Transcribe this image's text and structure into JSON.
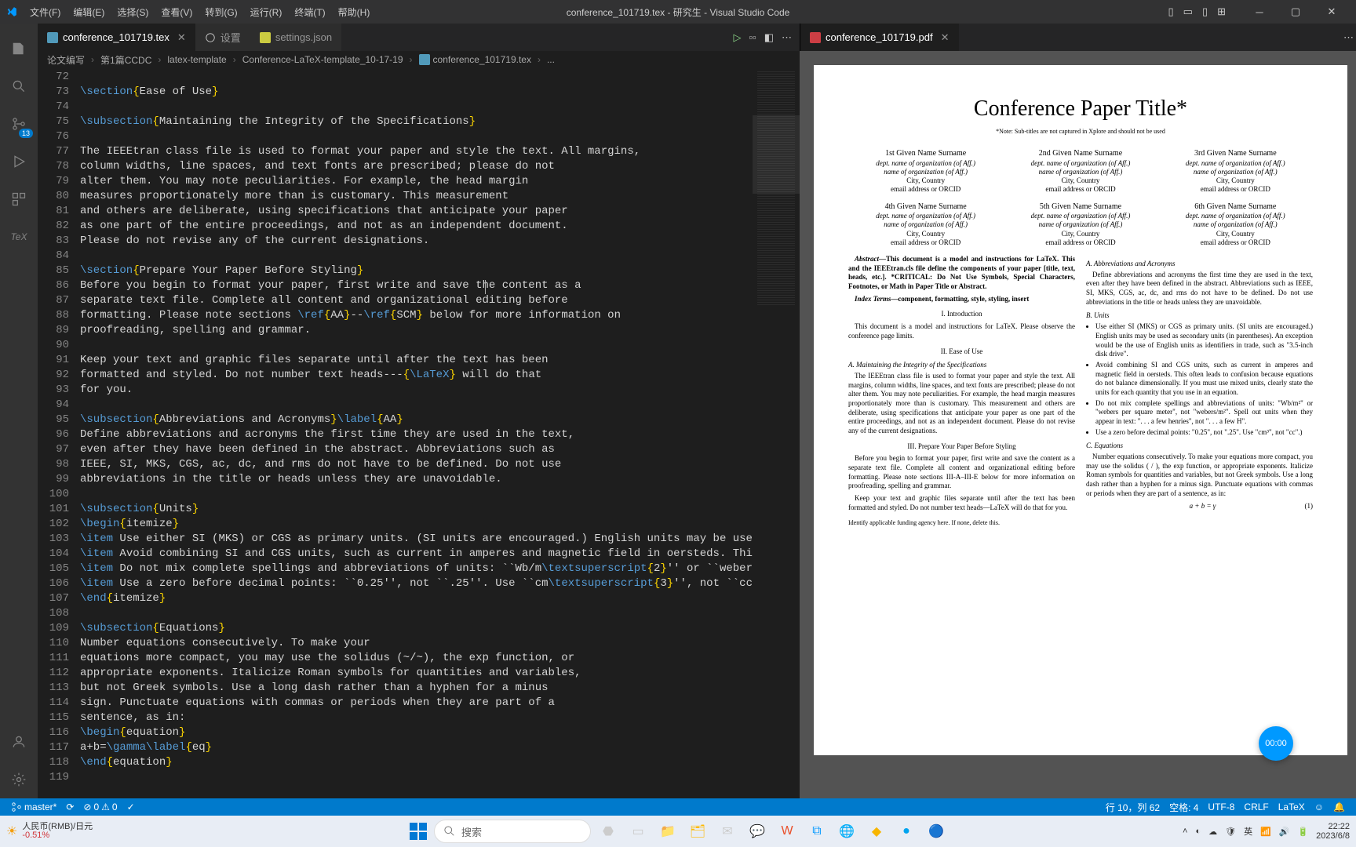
{
  "menubar": [
    "文件(F)",
    "编辑(E)",
    "选择(S)",
    "查看(V)",
    "转到(G)",
    "运行(R)",
    "终端(T)",
    "帮助(H)"
  ],
  "window_title": "conference_101719.tex - 研究生 - Visual Studio Code",
  "tabs_left": [
    {
      "label": "conference_101719.tex",
      "active": true
    },
    {
      "label": "设置",
      "active": false
    },
    {
      "label": "settings.json",
      "active": false
    }
  ],
  "tabs_right": [
    {
      "label": "conference_101719.pdf",
      "active": true
    }
  ],
  "breadcrumb": [
    "论文编写",
    "第1篇CCDC",
    "latex-template",
    "Conference-LaTeX-template_10-17-19",
    "conference_101719.tex",
    "..."
  ],
  "activity_badge": "13",
  "line_start": 72,
  "code_lines": [
    "",
    "\\section{Ease of Use}",
    "",
    "\\subsection{Maintaining the Integrity of the Specifications}",
    "",
    "The IEEEtran class file is used to format your paper and style the text. All margins, ",
    "column widths, line spaces, and text fonts are prescribed; please do not ",
    "alter them. You may note peculiarities. For example, the head margin",
    "measures proportionately more than is customary. This measurement ",
    "and others are deliberate, using specifications that anticipate your paper ",
    "as one part of the entire proceedings, and not as an independent document. ",
    "Please do not revise any of the current designations.",
    "",
    "\\section{Prepare Your Paper Before Styling}",
    "Before you begin to format your paper, first write and save the content as a ",
    "separate text file. Complete all content and organizational editing before ",
    "formatting. Please note sections \\ref{AA}--\\ref{SCM} below for more information on ",
    "proofreading, spelling and grammar.",
    "",
    "Keep your text and graphic files separate until after the text has been ",
    "formatted and styled. Do not number text heads---{\\LaTeX} will do that ",
    "for you.",
    "",
    "\\subsection{Abbreviations and Acronyms}\\label{AA}",
    "Define abbreviations and acronyms the first time they are used in the text, ",
    "even after they have been defined in the abstract. Abbreviations such as ",
    "IEEE, SI, MKS, CGS, ac, dc, and rms do not have to be defined. Do not use ",
    "abbreviations in the title or heads unless they are unavoidable.",
    "",
    "\\subsection{Units}",
    "\\begin{itemize}",
    "\\item Use either SI (MKS) or CGS as primary units. (SI units are encouraged.) English units may be use",
    "\\item Avoid combining SI and CGS units, such as current in amperes and magnetic field in oersteds. Thi",
    "\\item Do not mix complete spellings and abbreviations of units: ``Wb/m\\textsuperscript{2}'' or ``weber",
    "\\item Use a zero before decimal points: ``0.25'', not ``.25''. Use ``cm\\textsuperscript{3}'', not ``cc",
    "\\end{itemize}",
    "",
    "\\subsection{Equations}",
    "Number equations consecutively. To make your ",
    "equations more compact, you may use the solidus (~/~), the exp function, or ",
    "appropriate exponents. Italicize Roman symbols for quantities and variables, ",
    "but not Greek symbols. Use a long dash rather than a hyphen for a minus ",
    "sign. Punctuate equations with commas or periods when they are part of a ",
    "sentence, as in:",
    "\\begin{equation}",
    "a+b=\\gamma\\label{eq}",
    "\\end{equation}",
    ""
  ],
  "pdf": {
    "title": "Conference Paper Title*",
    "subtitle": "*Note: Sub-titles are not captured in Xplore and should not be used",
    "authors": [
      {
        "ord": "1st",
        "name": "Given Name Surname",
        "dept": "dept. name of organization (of Aff.)",
        "org": "name of organization (of Aff.)",
        "city": "City, Country",
        "email": "email address or ORCID"
      },
      {
        "ord": "2nd",
        "name": "Given Name Surname",
        "dept": "dept. name of organization (of Aff.)",
        "org": "name of organization (of Aff.)",
        "city": "City, Country",
        "email": "email address or ORCID"
      },
      {
        "ord": "3rd",
        "name": "Given Name Surname",
        "dept": "dept. name of organization (of Aff.)",
        "org": "name of organization (of Aff.)",
        "city": "City, Country",
        "email": "email address or ORCID"
      },
      {
        "ord": "4th",
        "name": "Given Name Surname",
        "dept": "dept. name of organization (of Aff.)",
        "org": "name of organization (of Aff.)",
        "city": "City, Country",
        "email": "email address or ORCID"
      },
      {
        "ord": "5th",
        "name": "Given Name Surname",
        "dept": "dept. name of organization (of Aff.)",
        "org": "name of organization (of Aff.)",
        "city": "City, Country",
        "email": "email address or ORCID"
      },
      {
        "ord": "6th",
        "name": "Given Name Surname",
        "dept": "dept. name of organization (of Aff.)",
        "org": "name of organization (of Aff.)",
        "city": "City, Country",
        "email": "email address or ORCID"
      }
    ],
    "abstract_label": "Abstract—",
    "abstract": "This document is a model and instructions for LaTeX. This and the IEEEtran.cls file define the components of your paper [title, text, heads, etc.]. *CRITICAL: Do Not Use Symbols, Special Characters, Footnotes, or Math in Paper Title or Abstract.",
    "index_label": "Index Terms—",
    "index": "component, formatting, style, styling, insert",
    "sec_intro": "I. Introduction",
    "intro_body": "This document is a model and instructions for LaTeX. Please observe the conference page limits.",
    "sec_ease": "II. Ease of Use",
    "sub_maint": "A. Maintaining the Integrity of the Specifications",
    "maint_body": "The IEEEtran class file is used to format your paper and style the text. All margins, column widths, line spaces, and text fonts are prescribed; please do not alter them. You may note peculiarities. For example, the head margin measures proportionately more than is customary. This measurement and others are deliberate, using specifications that anticipate your paper as one part of the entire proceedings, and not as an independent document. Please do not revise any of the current designations.",
    "sec_prep": "III. Prepare Your Paper Before Styling",
    "prep_body1": "Before you begin to format your paper, first write and save the content as a separate text file. Complete all content and organizational editing before formatting. Please note sections III-A–III-E below for more information on proofreading, spelling and grammar.",
    "prep_body2": "Keep your text and graphic files separate until after the text has been formatted and styled. Do not number text heads—LaTeX will do that for you.",
    "funding_note": "Identify applicable funding agency here. If none, delete this.",
    "sub_abbrev": "A. Abbreviations and Acronyms",
    "abbrev_body": "Define abbreviations and acronyms the first time they are used in the text, even after they have been defined in the abstract. Abbreviations such as IEEE, SI, MKS, CGS, ac, dc, and rms do not have to be defined. Do not use abbreviations in the title or heads unless they are unavoidable.",
    "sub_units": "B. Units",
    "units_items": [
      "Use either SI (MKS) or CGS as primary units. (SI units are encouraged.) English units may be used as secondary units (in parentheses). An exception would be the use of English units as identifiers in trade, such as \"3.5-inch disk drive\".",
      "Avoid combining SI and CGS units, such as current in amperes and magnetic field in oersteds. This often leads to confusion because equations do not balance dimensionally. If you must use mixed units, clearly state the units for each quantity that you use in an equation.",
      "Do not mix complete spellings and abbreviations of units: \"Wb/m²\" or \"webers per square meter\", not \"webers/m²\". Spell out units when they appear in text: \". . . a few henries\", not \". . . a few H\".",
      "Use a zero before decimal points: \"0.25\", not \".25\". Use \"cm³\", not \"cc\".)"
    ],
    "sub_eq": "C. Equations",
    "eq_body": "Number equations consecutively. To make your equations more compact, you may use the solidus ( / ), the exp function, or appropriate exponents. Italicize Roman symbols for quantities and variables, but not Greek symbols. Use a long dash rather than a hyphen for a minus sign. Punctuate equations with commas or periods when they are part of a sentence, as in:",
    "equation": "a + b = γ",
    "eq_num": "(1)"
  },
  "timer": "00:00",
  "status": {
    "branch": "master*",
    "errors": "0",
    "warnings": "0",
    "line_col": "行 10，列 62",
    "spaces": "空格: 4",
    "encoding": "UTF-8",
    "eol": "CRLF",
    "lang": "LaTeX",
    "check": "✓"
  },
  "taskbar": {
    "weather_line1": "人民币(RMB)/日元",
    "weather_line2": "-0.51%",
    "search_placeholder": "搜索",
    "time": "22:22",
    "date": "2023/6/8"
  }
}
